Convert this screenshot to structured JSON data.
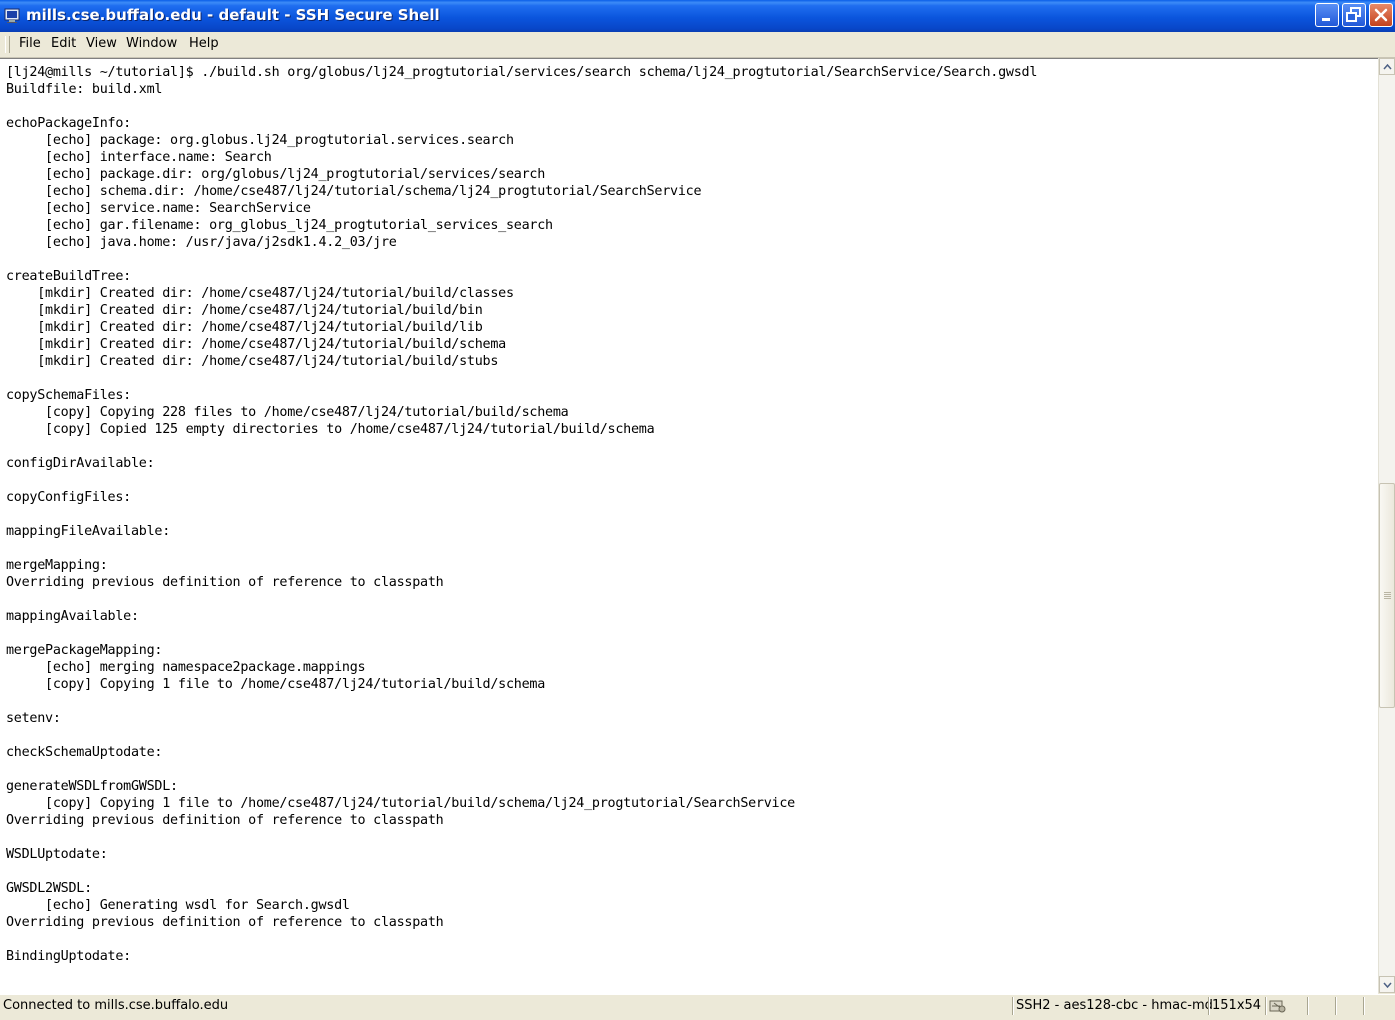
{
  "window": {
    "title": "mills.cse.buffalo.edu - default - SSH Secure Shell",
    "buttons": {
      "minimize": "minimize-icon",
      "maximize": "maximize-icon",
      "close": "close-icon"
    }
  },
  "menu": {
    "items": [
      {
        "label": "File"
      },
      {
        "label": "Edit"
      },
      {
        "label": "View"
      },
      {
        "label": "Window"
      },
      {
        "label": "Help"
      }
    ]
  },
  "terminal": {
    "lines": [
      "[lj24@mills ~/tutorial]$ ./build.sh org/globus/lj24_progtutorial/services/search schema/lj24_progtutorial/SearchService/Search.gwsdl",
      "Buildfile: build.xml",
      "",
      "echoPackageInfo:",
      "     [echo] package: org.globus.lj24_progtutorial.services.search",
      "     [echo] interface.name: Search",
      "     [echo] package.dir: org/globus/lj24_progtutorial/services/search",
      "     [echo] schema.dir: /home/cse487/lj24/tutorial/schema/lj24_progtutorial/SearchService",
      "     [echo] service.name: SearchService",
      "     [echo] gar.filename: org_globus_lj24_progtutorial_services_search",
      "     [echo] java.home: /usr/java/j2sdk1.4.2_03/jre",
      "",
      "createBuildTree:",
      "    [mkdir] Created dir: /home/cse487/lj24/tutorial/build/classes",
      "    [mkdir] Created dir: /home/cse487/lj24/tutorial/build/bin",
      "    [mkdir] Created dir: /home/cse487/lj24/tutorial/build/lib",
      "    [mkdir] Created dir: /home/cse487/lj24/tutorial/build/schema",
      "    [mkdir] Created dir: /home/cse487/lj24/tutorial/build/stubs",
      "",
      "copySchemaFiles:",
      "     [copy] Copying 228 files to /home/cse487/lj24/tutorial/build/schema",
      "     [copy] Copied 125 empty directories to /home/cse487/lj24/tutorial/build/schema",
      "",
      "configDirAvailable:",
      "",
      "copyConfigFiles:",
      "",
      "mappingFileAvailable:",
      "",
      "mergeMapping:",
      "Overriding previous definition of reference to classpath",
      "",
      "mappingAvailable:",
      "",
      "mergePackageMapping:",
      "     [echo] merging namespace2package.mappings",
      "     [copy] Copying 1 file to /home/cse487/lj24/tutorial/build/schema",
      "",
      "setenv:",
      "",
      "checkSchemaUptodate:",
      "",
      "generateWSDLfromGWSDL:",
      "     [copy] Copying 1 file to /home/cse487/lj24/tutorial/build/schema/lj24_progtutorial/SearchService",
      "Overriding previous definition of reference to classpath",
      "",
      "WSDLUptodate:",
      "",
      "GWSDL2WSDL:",
      "     [echo] Generating wsdl for Search.gwsdl",
      "Overriding previous definition of reference to classpath",
      "",
      "BindingUptodate:"
    ]
  },
  "status": {
    "connection": "Connected to mills.cse.buffalo.edu",
    "cipher": "SSH2 - aes128-cbc - hmac-md",
    "size": "151x54",
    "icon": "transfer-status-icon"
  }
}
